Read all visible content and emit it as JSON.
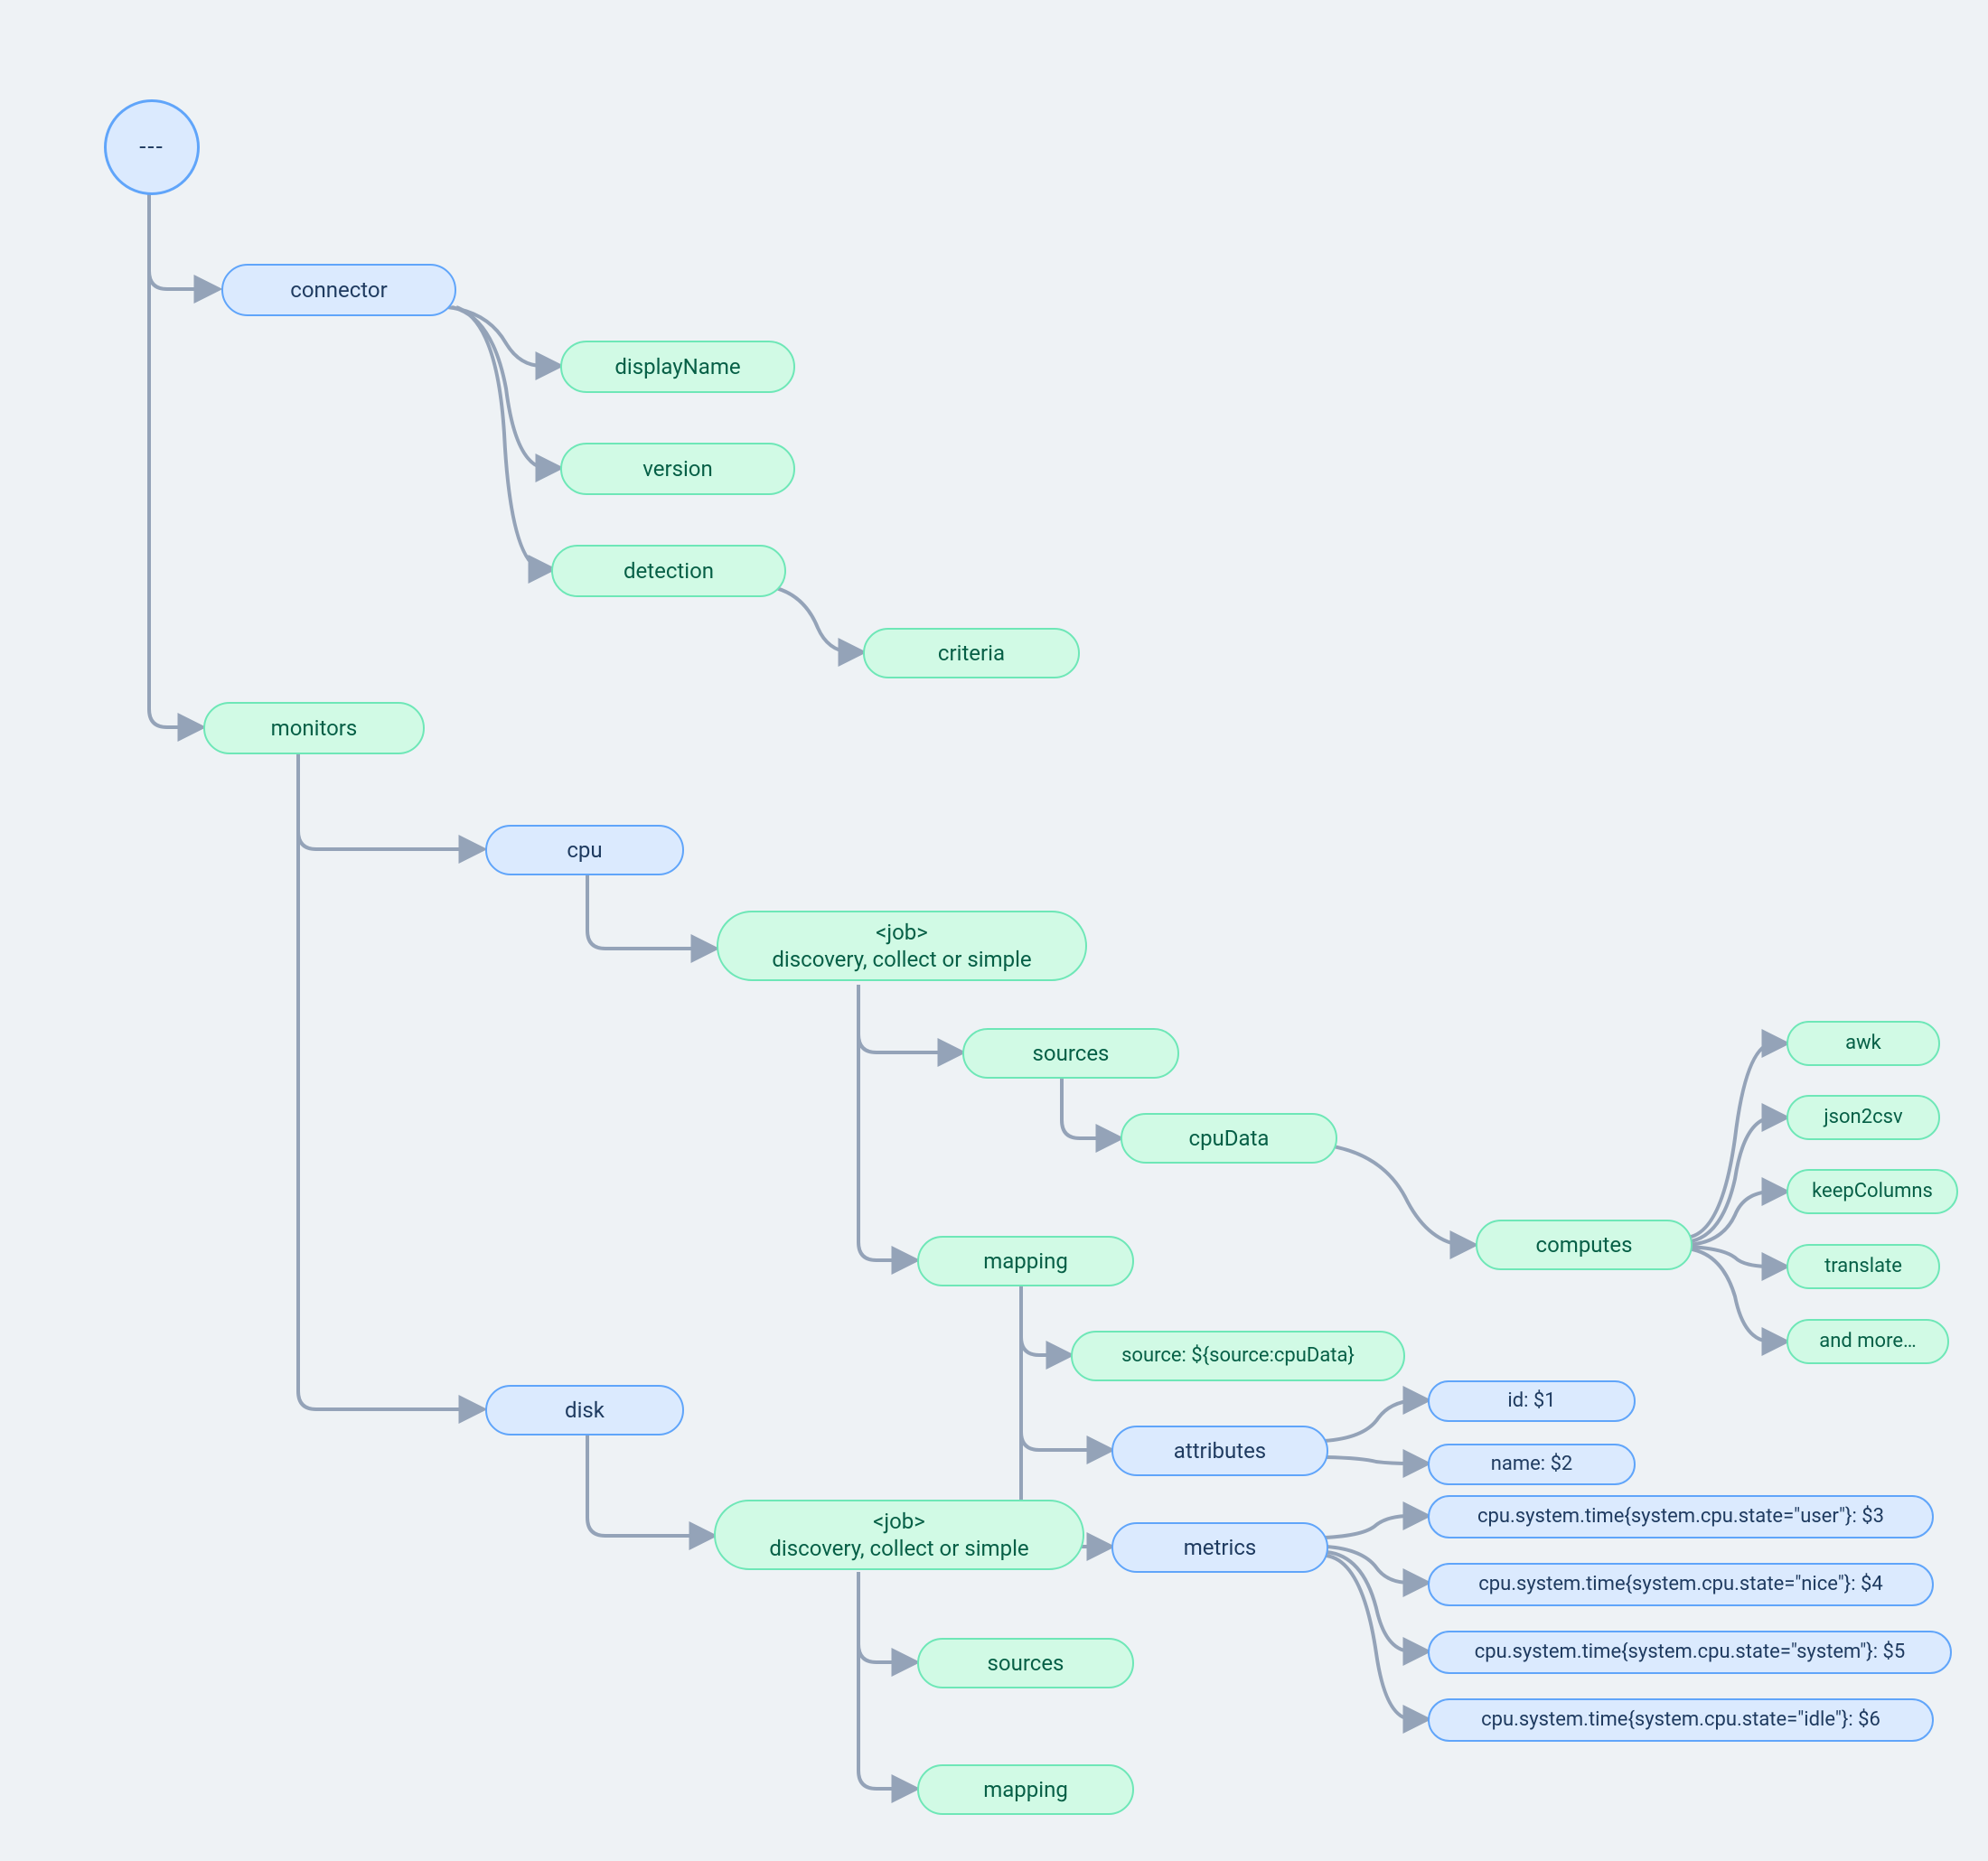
{
  "root": {
    "label": "---"
  },
  "connector": {
    "label": "connector",
    "children": {
      "displayName": "displayName",
      "version": "version",
      "detection": {
        "label": "detection",
        "criteria": "criteria"
      }
    }
  },
  "monitors": {
    "label": "monitors",
    "cpu": {
      "label": "cpu",
      "job": {
        "label": "<job>\ndiscovery, collect or simple",
        "sources": {
          "label": "sources",
          "cpuData": {
            "label": "cpuData",
            "computes": {
              "label": "computes",
              "ops": [
                "awk",
                "json2csv",
                "keepColumns",
                "translate",
                "and more…"
              ]
            }
          }
        },
        "mapping": {
          "label": "mapping",
          "source": "source: ${source:cpuData}",
          "attributes": {
            "label": "attributes",
            "items": [
              "id: $1",
              "name: $2"
            ]
          },
          "metrics": {
            "label": "metrics",
            "items": [
              "cpu.system.time{system.cpu.state=\"user\"}: $3",
              "cpu.system.time{system.cpu.state=\"nice\"}: $4",
              "cpu.system.time{system.cpu.state=\"system\"}: $5",
              "cpu.system.time{system.cpu.state=\"idle\"}: $6"
            ]
          }
        }
      }
    },
    "disk": {
      "label": "disk",
      "job": {
        "label": "<job>\ndiscovery, collect or simple",
        "sources": "sources",
        "mapping": "mapping"
      }
    }
  }
}
